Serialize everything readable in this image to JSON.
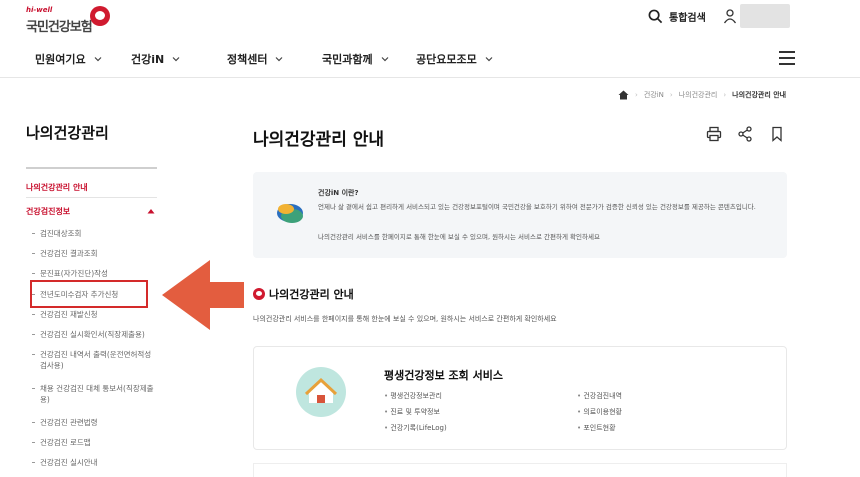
{
  "header": {
    "logo_sub": "hi-well",
    "logo_main": "국민건강보험",
    "search_label": "통합검색",
    "icons": {
      "search": "search-icon",
      "user": "user-icon",
      "menu": "hamburger-icon"
    }
  },
  "gnb": {
    "items": [
      "민원여기요",
      "건강iN",
      "정책센터",
      "국민과함께",
      "공단요모조모"
    ]
  },
  "breadcrumb": {
    "items": [
      "건강iN",
      "나의건강관리",
      "나의건강관리 안내"
    ]
  },
  "sidebar": {
    "title": "나의건강관리",
    "level1": [
      "나의건강관리 안내",
      "건강검진정보"
    ],
    "sub_items": [
      "검진대상조회",
      "건강검진 결과조회",
      "문진표(자가진단)작성",
      "전년도미수검자 추가신청",
      "건강검진 재발신청",
      "건강검진 실시확인서(직장제출용)",
      "건강검진 내역서 출력(운전면허적성검사용)",
      "채용 건강검진 대체 통보서(직장제출용)",
      "건강검진 관련법령",
      "건강검진 로드맵",
      "건강검진 실시안내"
    ]
  },
  "main": {
    "title": "나의건강관리 안내",
    "tools": [
      "print-icon",
      "share-icon",
      "bookmark-icon"
    ],
    "info": {
      "question": "건강iN 이란?",
      "text1": "언제나 삶 곁에서 쉽고 편리하게 서비스되고 있는 건강정보포털이며 국민건강을 보호하기 위하여 전문가가 검증한 신뢰성 있는 건강정보를 제공하는 콘텐츠입니다.",
      "text2": "나의건강관리 서비스를 한페이지로 통해 한눈에 보실 수 있으며, 원하시는 서비스로 간편하게 확인하세요"
    },
    "section": {
      "title": "나의건강관리 안내",
      "desc": "나의건강관리 서비스를 한페이지를 통해 한눈에 보실 수 있으며, 원하시는 서비스로 간편하게 확인하세요"
    },
    "service": {
      "title": "평생건강정보 조회 서비스",
      "left_items": [
        "평생건강정보관리",
        "진료 및 투약정보",
        "건강기록(LifeLog)"
      ],
      "right_items": [
        "건강검진내역",
        "의료이용현황",
        "포인트현황"
      ]
    }
  },
  "colors": {
    "brand_red": "#d01a2f",
    "highlight": "#d42a2a",
    "arrow": "#e35d3f"
  }
}
